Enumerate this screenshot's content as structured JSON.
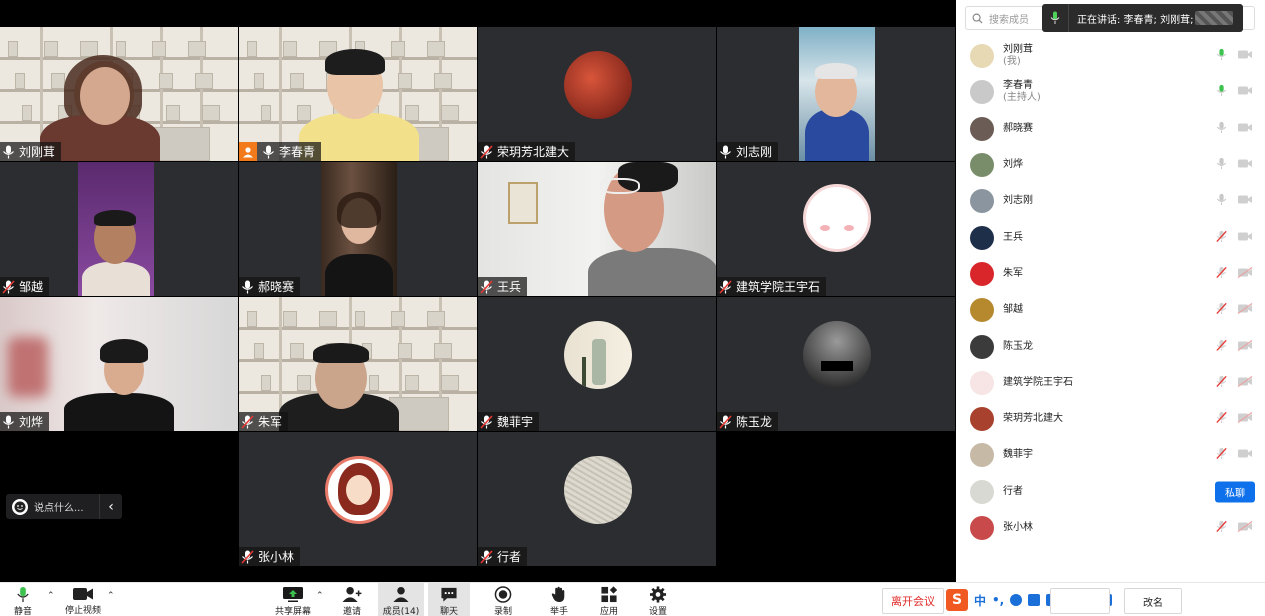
{
  "grid": {
    "tiles": [
      {
        "name": "刘刚茸",
        "mic": "on",
        "kind": "camera-shelf",
        "speaking": false,
        "host": false
      },
      {
        "name": "李春青",
        "mic": "on",
        "kind": "camera-shelf",
        "speaking": true,
        "host": true
      },
      {
        "name": "荣玥芳北建大",
        "mic": "muted",
        "kind": "avatar-red"
      },
      {
        "name": "刘志刚",
        "mic": "on",
        "kind": "camera-portrait"
      },
      {
        "name": "邹越",
        "mic": "muted",
        "kind": "camera-portrait-purple"
      },
      {
        "name": "郝晓赛",
        "mic": "on",
        "kind": "camera-portrait-dark"
      },
      {
        "name": "王兵",
        "mic": "muted",
        "kind": "camera-room"
      },
      {
        "name": "建筑学院王宇石",
        "mic": "muted",
        "kind": "avatar-face"
      },
      {
        "name": "刘烨",
        "mic": "on",
        "kind": "camera-blur"
      },
      {
        "name": "朱军",
        "mic": "muted",
        "kind": "camera-shelf"
      },
      {
        "name": "魏菲宇",
        "mic": "muted",
        "kind": "avatar-art"
      },
      {
        "name": "陈玉龙",
        "mic": "muted",
        "kind": "avatar-silhouette"
      },
      {
        "name": "张小林",
        "mic": "muted",
        "kind": "avatar-cartoon"
      },
      {
        "name": "行者",
        "mic": "muted",
        "kind": "avatar-sketch"
      }
    ]
  },
  "chat_mini": {
    "placeholder": "说点什么..."
  },
  "panel": {
    "search_placeholder": "搜索成员",
    "speaking_label": "正在讲话: 李春青; 刘刚茸;",
    "members": [
      {
        "name": "刘刚茸",
        "sub": "(我)",
        "mic": "on-green",
        "video": "off",
        "av": "#e8d9b5"
      },
      {
        "name": "李春青",
        "sub": "(主持人)",
        "mic": "on-green",
        "video": "off",
        "av": "#c9c9c9"
      },
      {
        "name": "郝晓赛",
        "sub": "",
        "mic": "on",
        "video": "off",
        "av": "#6b5c55"
      },
      {
        "name": "刘烨",
        "sub": "",
        "mic": "on",
        "video": "off",
        "av": "#7a8d6a"
      },
      {
        "name": "刘志刚",
        "sub": "",
        "mic": "on",
        "video": "off",
        "av": "#8a95a0"
      },
      {
        "name": "王兵",
        "sub": "",
        "mic": "muted",
        "video": "off",
        "av": "#1e2f4a"
      },
      {
        "name": "朱军",
        "sub": "",
        "mic": "muted",
        "video": "off-red",
        "av": "#d8262a"
      },
      {
        "name": "邹越",
        "sub": "",
        "mic": "muted",
        "video": "off-red",
        "av": "#b7892f"
      },
      {
        "name": "陈玉龙",
        "sub": "",
        "mic": "muted",
        "video": "off-red",
        "av": "#3b3b3b"
      },
      {
        "name": "建筑学院王宇石",
        "sub": "",
        "mic": "muted",
        "video": "off-red",
        "av": "#f7e4e4"
      },
      {
        "name": "荣玥芳北建大",
        "sub": "",
        "mic": "muted",
        "video": "off-red",
        "av": "#a8412d"
      },
      {
        "name": "魏菲宇",
        "sub": "",
        "mic": "muted",
        "video": "off",
        "av": "#c6b9a6"
      },
      {
        "name": "行者",
        "sub": "",
        "mic": "none",
        "video": "none",
        "av": "#d9d9d3",
        "pm": "私聊"
      },
      {
        "name": "张小林",
        "sub": "",
        "mic": "muted",
        "video": "off-red",
        "av": "#c94a4a"
      }
    ]
  },
  "toolbar": {
    "mute": "静音",
    "stop_video": "停止视频",
    "share": "共享屏幕",
    "invite": "邀请",
    "members": "成员(14)",
    "chat": "聊天",
    "record": "录制",
    "raise_hand": "举手",
    "apps": "应用",
    "settings": "设置",
    "leave": "离开会议",
    "rename": "改名"
  },
  "ime": {
    "lang": "中"
  }
}
